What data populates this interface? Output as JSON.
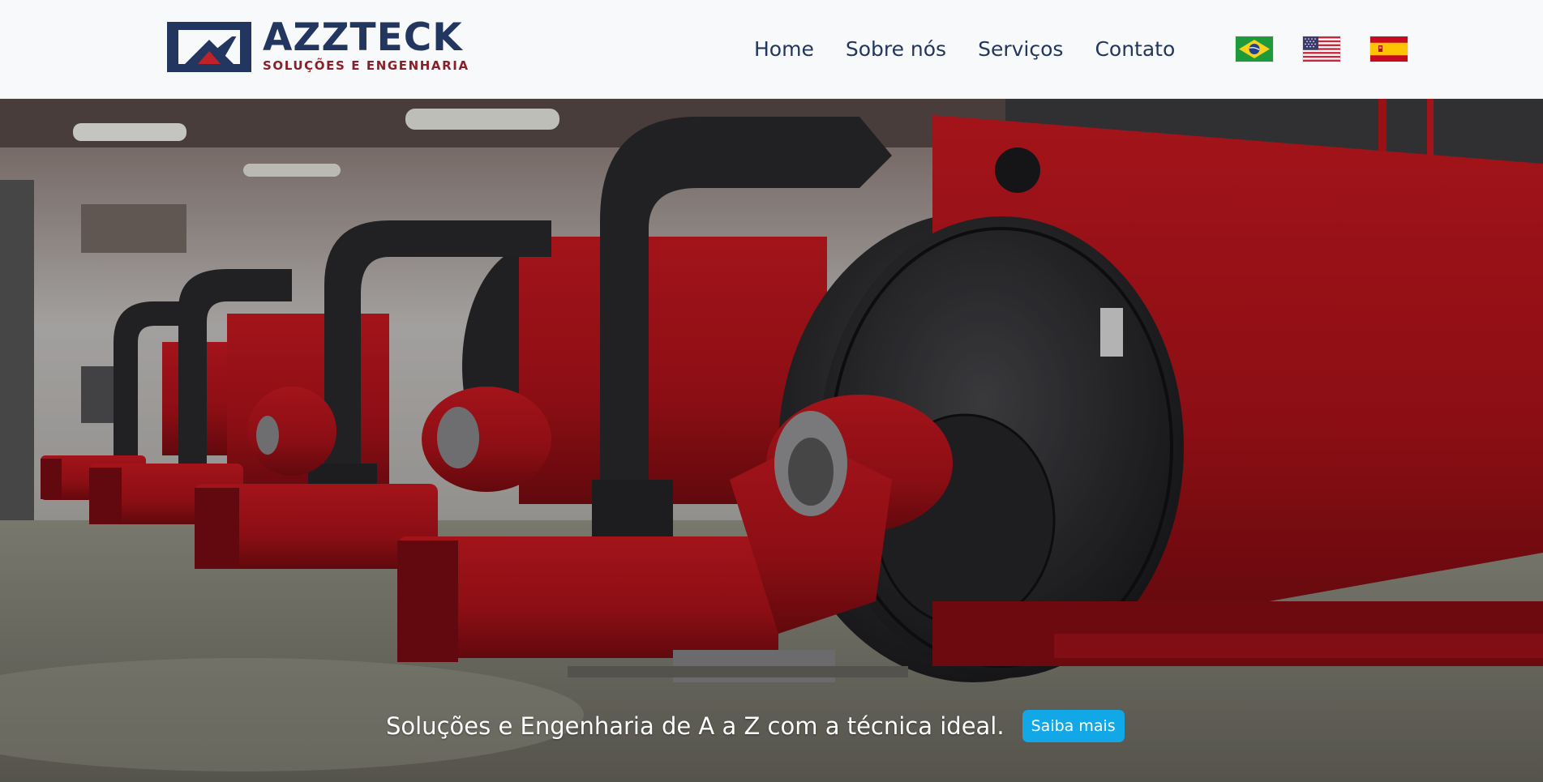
{
  "brand": {
    "name": "AZZTECK",
    "subtitle": "SOLUÇÕES E ENGENHARIA",
    "logo_icon": "azzteck-mountain-logo-icon"
  },
  "nav": {
    "items": [
      {
        "label": "Home"
      },
      {
        "label": "Sobre nós"
      },
      {
        "label": "Serviços"
      },
      {
        "label": "Contato"
      }
    ]
  },
  "languages": [
    {
      "icon": "brazil-flag-icon"
    },
    {
      "icon": "usa-flag-icon"
    },
    {
      "icon": "spain-flag-icon"
    }
  ],
  "hero": {
    "tagline": "Soluções e Engenharia de A a Z com a técnica ideal.",
    "button_label": "Saiba mais",
    "image": "industrial-red-boilers-image"
  },
  "colors": {
    "navy": "#22365f",
    "brand_red": "#8b1f28",
    "button_blue": "#12a8e8",
    "boiler_red": "#c4161c"
  }
}
